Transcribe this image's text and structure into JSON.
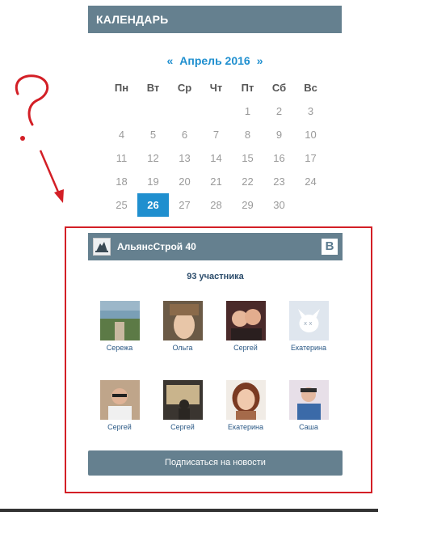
{
  "calendar": {
    "header": "КАЛЕНДАРЬ",
    "prev": "«",
    "month": "Апрель 2016",
    "next": "»",
    "weekdays": [
      "Пн",
      "Вт",
      "Ср",
      "Чт",
      "Пт",
      "Сб",
      "Вс"
    ],
    "weeks": [
      [
        "",
        "",
        "",
        "",
        "1",
        "2",
        "3"
      ],
      [
        "4",
        "5",
        "6",
        "7",
        "8",
        "9",
        "10"
      ],
      [
        "11",
        "12",
        "13",
        "14",
        "15",
        "16",
        "17"
      ],
      [
        "18",
        "19",
        "20",
        "21",
        "22",
        "23",
        "24"
      ],
      [
        "25",
        "26",
        "27",
        "28",
        "29",
        "30",
        ""
      ]
    ],
    "today": "26",
    "accent": "#1f8fcf"
  },
  "widget": {
    "group_name": "АльянсСтрой 40",
    "logo": "В",
    "members_count": "93 участника",
    "members": [
      {
        "name": "Сережа"
      },
      {
        "name": "Ольга"
      },
      {
        "name": "Сергей"
      },
      {
        "name": "Екатерина"
      },
      {
        "name": "Сергей"
      },
      {
        "name": "Сергей"
      },
      {
        "name": "Екатерина"
      },
      {
        "name": "Саша"
      }
    ],
    "subscribe_label": "Подписаться на новости",
    "header_color": "#65808f"
  },
  "annotation": {
    "mark": "?",
    "color": "#d31f26"
  }
}
